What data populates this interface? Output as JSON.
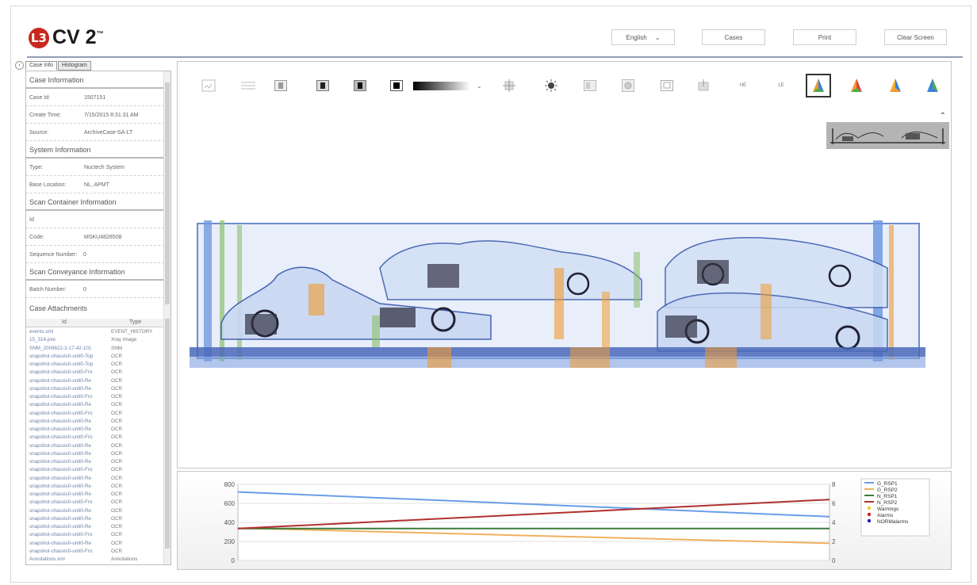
{
  "header": {
    "brand_mark": "L3",
    "brand_name": "CV 2",
    "brand_tm": "™",
    "language": "English",
    "cases_label": "Cases",
    "print_label": "Print",
    "clear_label": "Clear Screen"
  },
  "left_panel": {
    "tabs": [
      "Case Info",
      "Histogram"
    ],
    "case_information": {
      "title": "Case Information",
      "case_id_label": "Case Id:",
      "case_id": "1507151",
      "create_time_label": "Create Time:",
      "create_time": "7/15/2015 8:31:31 AM",
      "source_label": "Source:",
      "source": "ArchiveCase-SA-LT"
    },
    "system_information": {
      "title": "System Information",
      "type_label": "Type:",
      "type": "Nuctech System",
      "base_location_label": "Base Location:",
      "base_location": "NL, APMT"
    },
    "scan_container": {
      "title": "Scan Container Information",
      "id_label": "Id",
      "code_label": "Code:",
      "code": "MSKU4828508",
      "sequence_label": "Sequence Number:",
      "sequence": "0"
    },
    "scan_conveyance": {
      "title": "Scan Conveyance Information",
      "batch_label": "Batch Number:",
      "batch": "0"
    },
    "attachments": {
      "title": "Case Attachments",
      "col_id": "Id",
      "col_type": "Type",
      "rows": [
        {
          "name": "events.xml",
          "type": "EVENT_HISTORY"
        },
        {
          "name": "15_314.pxe",
          "type": "Xray Image"
        },
        {
          "name": "SNM_2009622-2-17-42-101",
          "type": "SNM"
        },
        {
          "name": "snapshot-chassis0-unit0-Top",
          "type": "OCR"
        },
        {
          "name": "snapshot-chassis0-unit0-Top",
          "type": "OCR"
        },
        {
          "name": "snapshot-chassis0-unit0-Fro",
          "type": "OCR"
        },
        {
          "name": "snapshot-chassis0-unit0-Re",
          "type": "OCR"
        },
        {
          "name": "snapshot-chassis0-unit0-Re",
          "type": "OCR"
        },
        {
          "name": "snapshot-chassis0-unit0-Fro",
          "type": "OCR"
        },
        {
          "name": "snapshot-chassis0-unit0-Re",
          "type": "OCR"
        },
        {
          "name": "snapshot-chassis0-unit0-Fro",
          "type": "OCR"
        },
        {
          "name": "snapshot-chassis0-unit0-Re",
          "type": "OCR"
        },
        {
          "name": "snapshot-chassis0-unit0-Re",
          "type": "OCR"
        },
        {
          "name": "snapshot-chassis0-unit0-Fro",
          "type": "OCR"
        },
        {
          "name": "snapshot-chassis0-unit0-Re",
          "type": "OCR"
        },
        {
          "name": "snapshot-chassis0-unit0-Re",
          "type": "OCR"
        },
        {
          "name": "snapshot-chassis0-unit0-Re",
          "type": "OCR"
        },
        {
          "name": "snapshot-chassis0-unit0-Fro",
          "type": "OCR"
        },
        {
          "name": "snapshot-chassis0-unit0-Re",
          "type": "OCR"
        },
        {
          "name": "snapshot-chassis0-unit0-Re",
          "type": "OCR"
        },
        {
          "name": "snapshot-chassis0-unit0-Re",
          "type": "OCR"
        },
        {
          "name": "snapshot-chassis0-unit0-Fro",
          "type": "OCR"
        },
        {
          "name": "snapshot-chassis0-unit0-Re",
          "type": "OCR"
        },
        {
          "name": "snapshot-chassis0-unit0-Re",
          "type": "OCR"
        },
        {
          "name": "snapshot-chassis0-unit0-Re",
          "type": "OCR"
        },
        {
          "name": "snapshot-chassis0-unit0-Fro",
          "type": "OCR"
        },
        {
          "name": "snapshot-chassis0-unit0-Re",
          "type": "OCR"
        },
        {
          "name": "snapshot-chassis0-unit0-Fro",
          "type": "OCR"
        },
        {
          "name": "Annotations.xml",
          "type": "Annotations"
        }
      ]
    }
  },
  "toolbar": {
    "icons": [
      "image-icon",
      "lines-icon",
      "contrast-1-icon",
      "contrast-2-icon",
      "contrast-3-icon",
      "contrast-4-icon",
      "gradient-select",
      "crosshair-icon",
      "sun-icon",
      "invert-icon",
      "blur-icon",
      "zoom-region-icon",
      "edge-icon",
      "he-label",
      "le-label",
      "colormap-1-icon",
      "colormap-2-icon",
      "colormap-3-icon",
      "colormap-4-icon"
    ],
    "he_label": "HE",
    "le_label": "LE"
  },
  "colors": {
    "accent": "#8fa0b6",
    "brand_red": "#c8281e",
    "series_g_rsp1": "#6a9ee8",
    "series_g_rsp2": "#f0b060",
    "series_n_rsp1": "#3c7a3c",
    "series_n_rsp2": "#b03030",
    "warnings": "#f0d030",
    "alarms": "#d02020",
    "norm_alarms": "#2020c0"
  },
  "chart_data": {
    "type": "line",
    "x": [
      0,
      1
    ],
    "ylim": [
      0,
      800
    ],
    "y2lim": [
      0,
      8
    ],
    "y_ticks": [
      0,
      200,
      400,
      600,
      800
    ],
    "y2_ticks": [
      0,
      2,
      4,
      6,
      8
    ],
    "grid": true,
    "legend_placement": "right",
    "series": [
      {
        "name": "G_RSP1",
        "values": [
          720,
          460
        ]
      },
      {
        "name": "G_RSP2",
        "values": [
          340,
          180
        ]
      },
      {
        "name": "N_RSP1",
        "values": [
          335,
          335
        ]
      },
      {
        "name": "N_RSP2",
        "values": [
          335,
          640
        ]
      }
    ],
    "legend": [
      "G_RSP1",
      "G_RSP2",
      "N_RSP1",
      "N_RSP2",
      "Warnings",
      "Alarms",
      "NORMalarms"
    ]
  }
}
